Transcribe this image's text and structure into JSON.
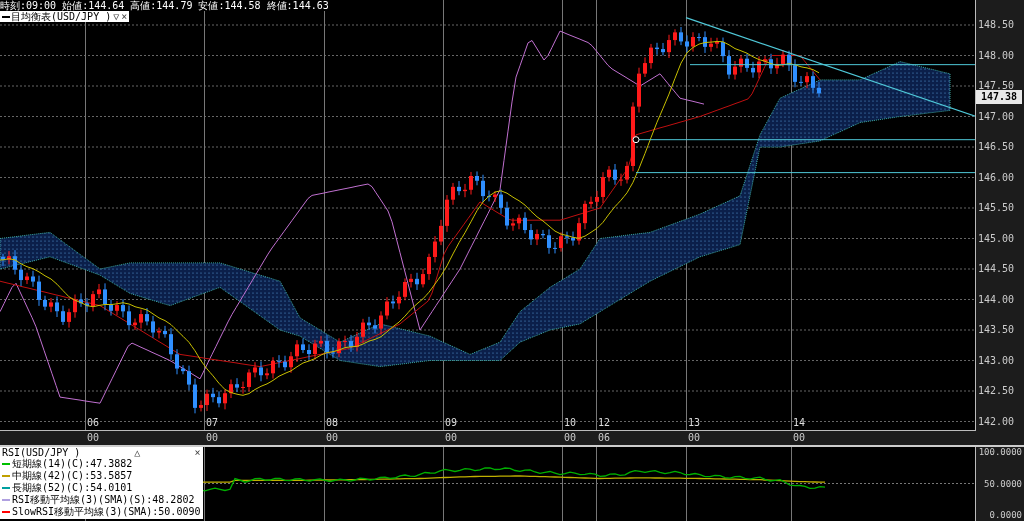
{
  "header": [
    {
      "text": "時刻:09:00"
    },
    {
      "text": "始値:144.64"
    },
    {
      "text": "高値:144.79"
    },
    {
      "text": "安値:144.58"
    },
    {
      "text": "終値:144.63"
    }
  ],
  "main_legend": {
    "title": "目均衡表(USD/JPY )",
    "buttons": [
      "▽",
      "×"
    ]
  },
  "price_axis": {
    "labels": [
      "148.50",
      "148.00",
      "147.50",
      "147.00",
      "146.50",
      "146.00",
      "145.50",
      "145.00",
      "144.50",
      "144.00",
      "143.50",
      "143.00",
      "142.50",
      "142.00"
    ],
    "current": "147.38"
  },
  "time_axis": [
    {
      "date": "06",
      "time": "00"
    },
    {
      "date": "07",
      "time": "00"
    },
    {
      "date": "08",
      "time": "00"
    },
    {
      "date": "09",
      "time": "00"
    },
    {
      "date": "10",
      "time": "00"
    },
    {
      "date": "12",
      "time": "06"
    },
    {
      "date": "13",
      "time": "00"
    },
    {
      "date": "14",
      "time": "00"
    }
  ],
  "rsi": {
    "title": "RSI(USD/JPY )",
    "buttons": [
      "△",
      "×"
    ],
    "series": [
      {
        "label": "短期線(14)(C):47.3882",
        "color": "#00c000"
      },
      {
        "label": "中期線(42)(C):53.5857",
        "color": "#c0a000"
      },
      {
        "label": "長期線(52)(C):54.0101",
        "color": "#00a0a0"
      },
      {
        "label": "RSI移動平均線(3)(SMA)(S):48.2802",
        "color": "#b0a0e0"
      },
      {
        "label": "SlowRSI移動平均線(3)(SMA):50.0090",
        "color": "#ff0000"
      }
    ],
    "axis": [
      "100.0000",
      "50.0000",
      "0.0000"
    ]
  }
}
